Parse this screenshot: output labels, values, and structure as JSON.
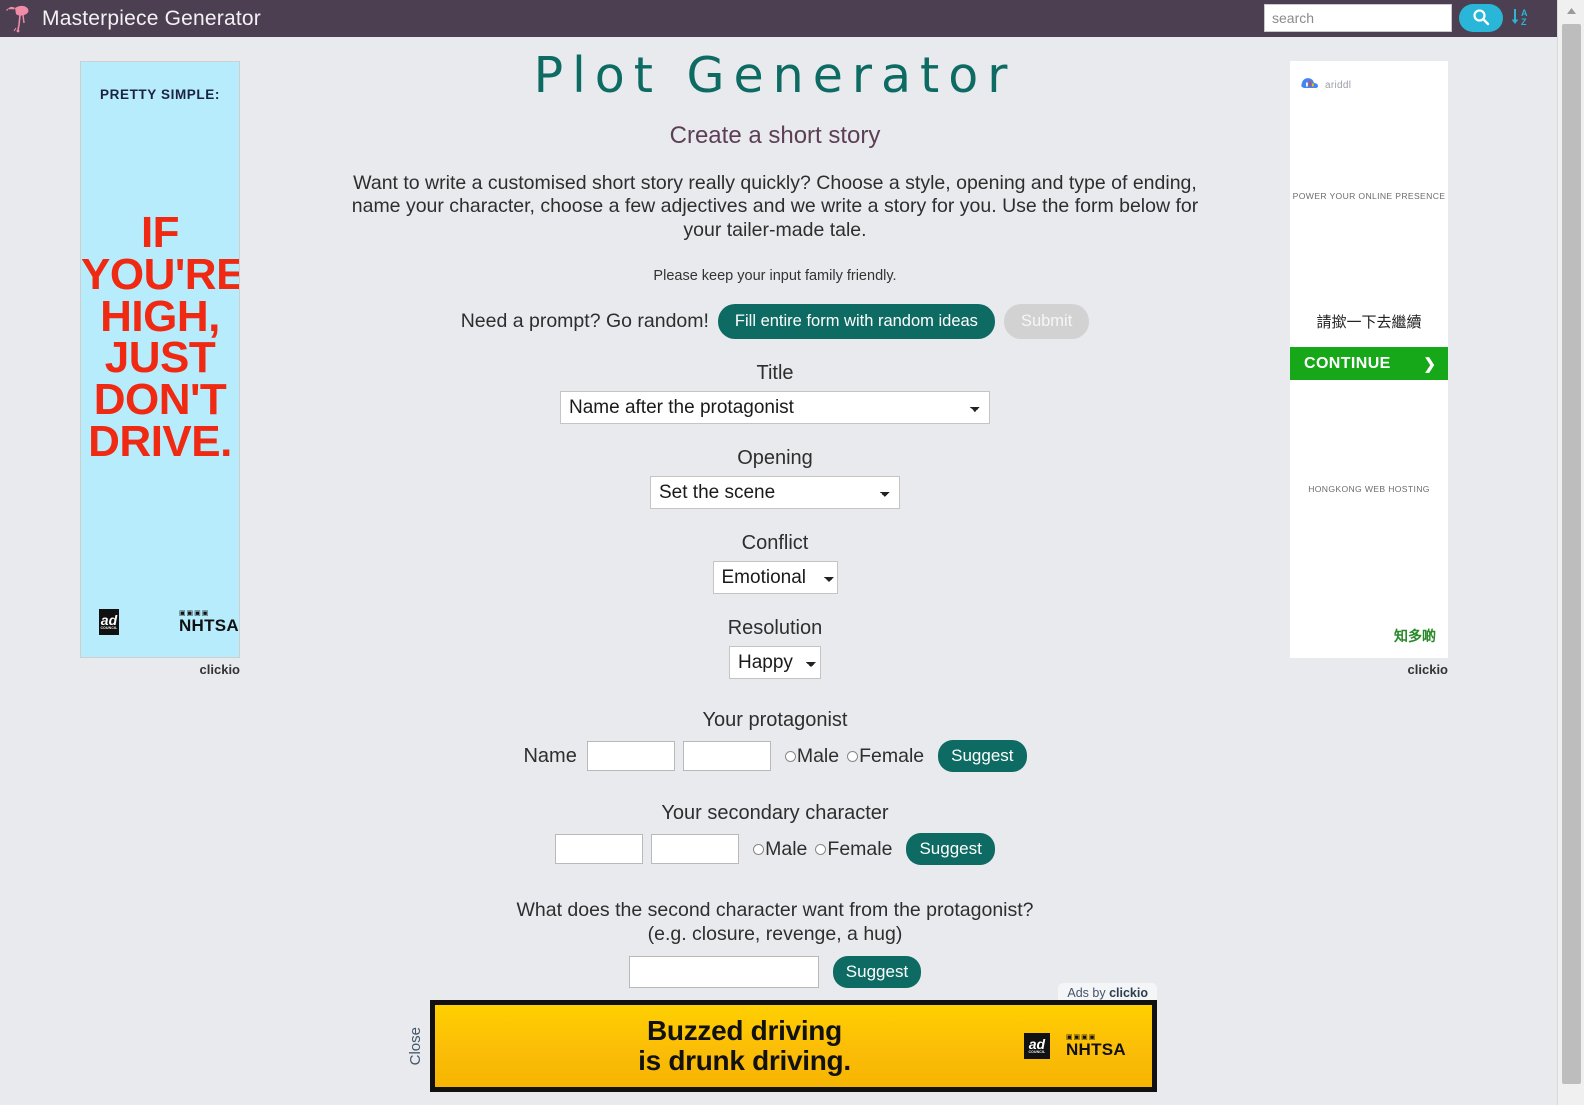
{
  "header": {
    "brand_title": "Masterpiece Generator",
    "logo_icon": "flamingo-logo-icon",
    "search_placeholder": "search",
    "search_value": "",
    "search_icon": "search-icon",
    "sort_icon": "sort-alpha-icon",
    "bg_color": "#4c3f51",
    "search_button_color": "#29b6d8"
  },
  "main": {
    "title": "Plot Generator",
    "subtitle": "Create a short story",
    "intro": "Want to write a customised short story really quickly? Choose a style, opening and type of ending, name your character, choose a few adjectives and we write a story for you. Use the form below for your tailer-made tale.",
    "family_note": "Please keep your input family friendly.",
    "title_color": "#0d6b63",
    "subtitle_color": "#5c3f56"
  },
  "random": {
    "label": "Need a prompt? Go random!",
    "fill_button": "Fill entire form with random ideas",
    "submit_button": "Submit"
  },
  "form": {
    "title": {
      "label": "Title",
      "value": "Name after the protagonist",
      "options": [
        "Name after the protagonist"
      ]
    },
    "opening": {
      "label": "Opening",
      "value": "Set the scene",
      "options": [
        "Set the scene"
      ]
    },
    "conflict": {
      "label": "Conflict",
      "value": "Emotional",
      "options": [
        "Emotional"
      ]
    },
    "resolution": {
      "label": "Resolution",
      "value": "Happy",
      "options": [
        "Happy"
      ]
    },
    "protagonist": {
      "heading": "Your protagonist",
      "name_label": "Name",
      "first_name": "",
      "last_name": "",
      "male_label": "Male",
      "female_label": "Female",
      "suggest_label": "Suggest"
    },
    "secondary": {
      "heading": "Your secondary character",
      "first_name": "",
      "last_name": "",
      "male_label": "Male",
      "female_label": "Female",
      "suggest_label": "Suggest"
    },
    "want": {
      "question_line1": "What does the second character want from the protagonist?",
      "question_line2": "(e.g. closure, revenge, a hug)",
      "value": "",
      "suggest_label": "Suggest"
    }
  },
  "left_ad": {
    "headline": "PRETTY SIMPLE:",
    "body_lines": [
      "IF",
      "YOU'RE",
      "HIGH,",
      "JUST",
      "DON'T",
      "DRIVE."
    ],
    "adcouncil_top": "ad",
    "adcouncil_bottom": "COUNCIL",
    "nhtsa_squares": "▣▣▣▣",
    "nhtsa_text": "NHTSA",
    "attribution": "clickio",
    "bg_color": "#b6ecfb",
    "text_color": "#f02a12"
  },
  "right_ad": {
    "brand": "ariddl",
    "tagline1": "POWER YOUR ONLINE PRESENCE",
    "cn_prompt": "請撳一下去繼續",
    "continue_label": "CONTINUE",
    "continue_chevron": "❯",
    "tagline2": "HONGKONG WEB HOSTING",
    "cn_more": "知多啲",
    "attribution": "clickio",
    "button_color": "#16a819"
  },
  "bottom_ad": {
    "ads_by_prefix": "Ads by ",
    "ads_by_brand": "clickio",
    "close_label": "Close",
    "banner_line1": "Buzzed driving",
    "banner_line2": "is drunk driving.",
    "adcouncil_top": "ad",
    "adcouncil_bottom": "COUNCIL",
    "nhtsa_squares": "▣▣▣▣",
    "nhtsa_text": "NHTSA",
    "bg_color": "#fbbd07"
  }
}
